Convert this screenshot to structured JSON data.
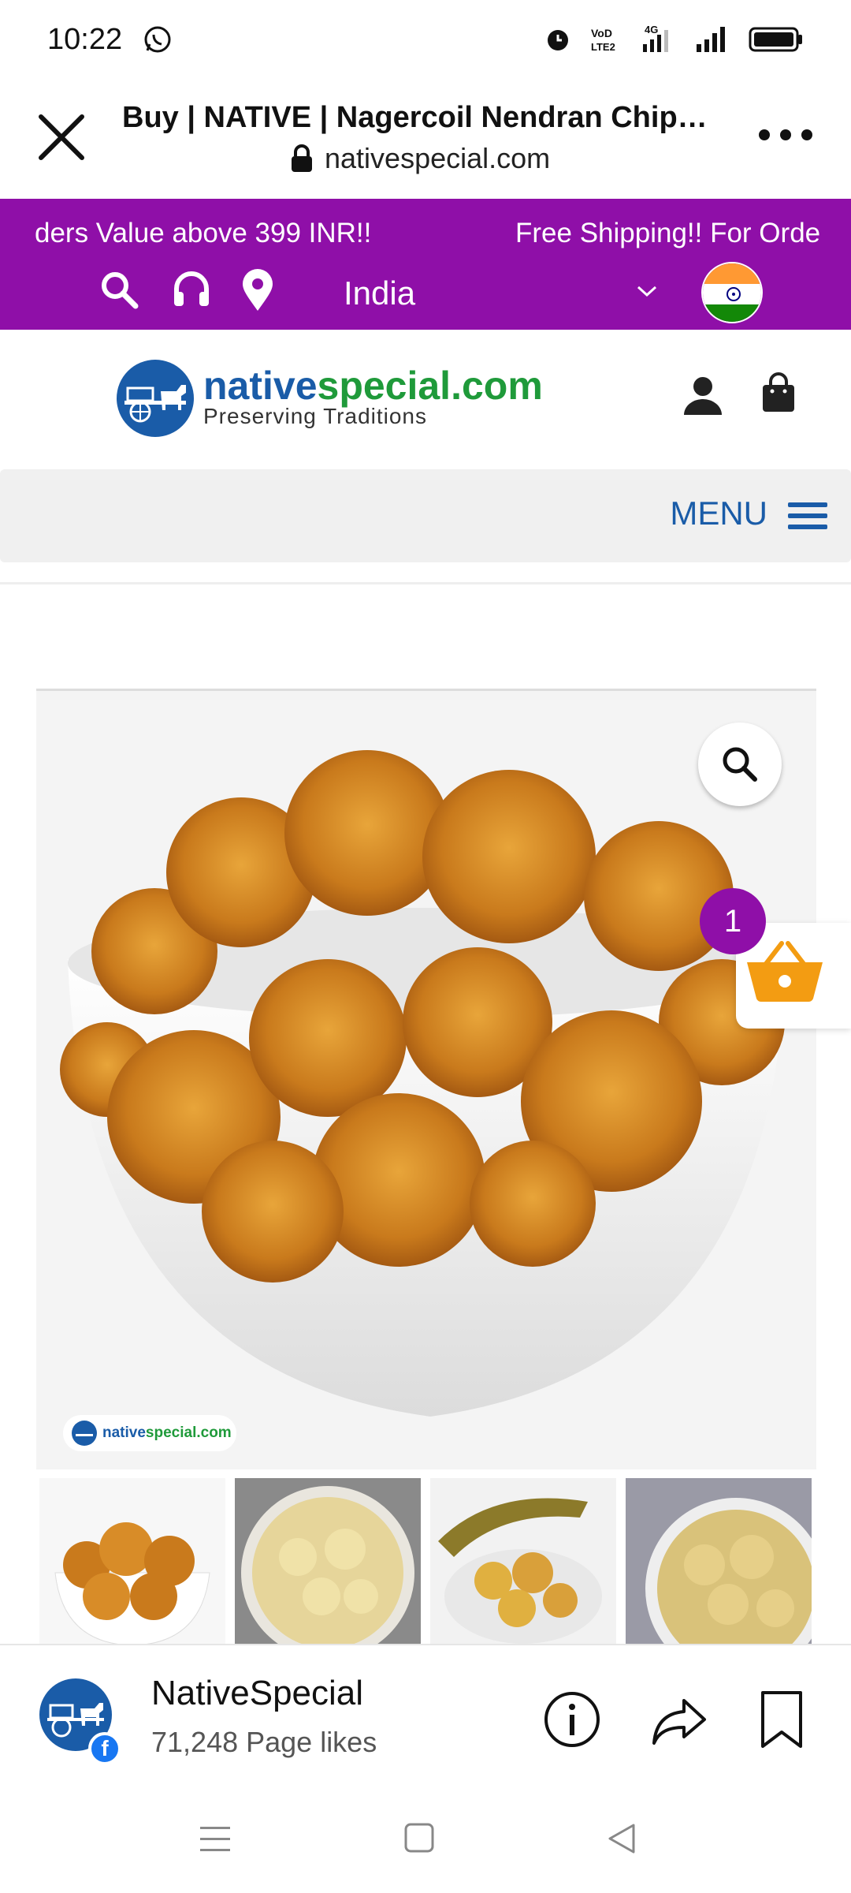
{
  "status_bar": {
    "time": "10:22",
    "icons": [
      "whatsapp-icon",
      "alarm-icon",
      "volte-icon",
      "4g-signal-icon",
      "signal-icon",
      "battery-icon"
    ]
  },
  "browser": {
    "title": "Buy | NATIVE | Nagercoil Nendran Chips o...",
    "url": "nativespecial.com"
  },
  "promo_bar": {
    "marquee_left": "ders Value above 399 INR!!",
    "marquee_right": "Free Shipping!! For Orde",
    "country": "India",
    "background": "#8f0fa8"
  },
  "brand": {
    "name_part1": "native",
    "name_part2": "special.com",
    "tagline": "Preserving Traditions"
  },
  "menu": {
    "label": "MENU"
  },
  "product": {
    "watermark_part1": "native",
    "watermark_part2": "special.com",
    "cart_count": "1"
  },
  "fb_bar": {
    "page_name": "NativeSpecial",
    "page_likes": "71,248 Page likes"
  },
  "colors": {
    "brand_blue": "#1a5ca8",
    "brand_green": "#1f9a3a",
    "purple": "#8f0fa8",
    "cart_orange": "#f39c12"
  }
}
